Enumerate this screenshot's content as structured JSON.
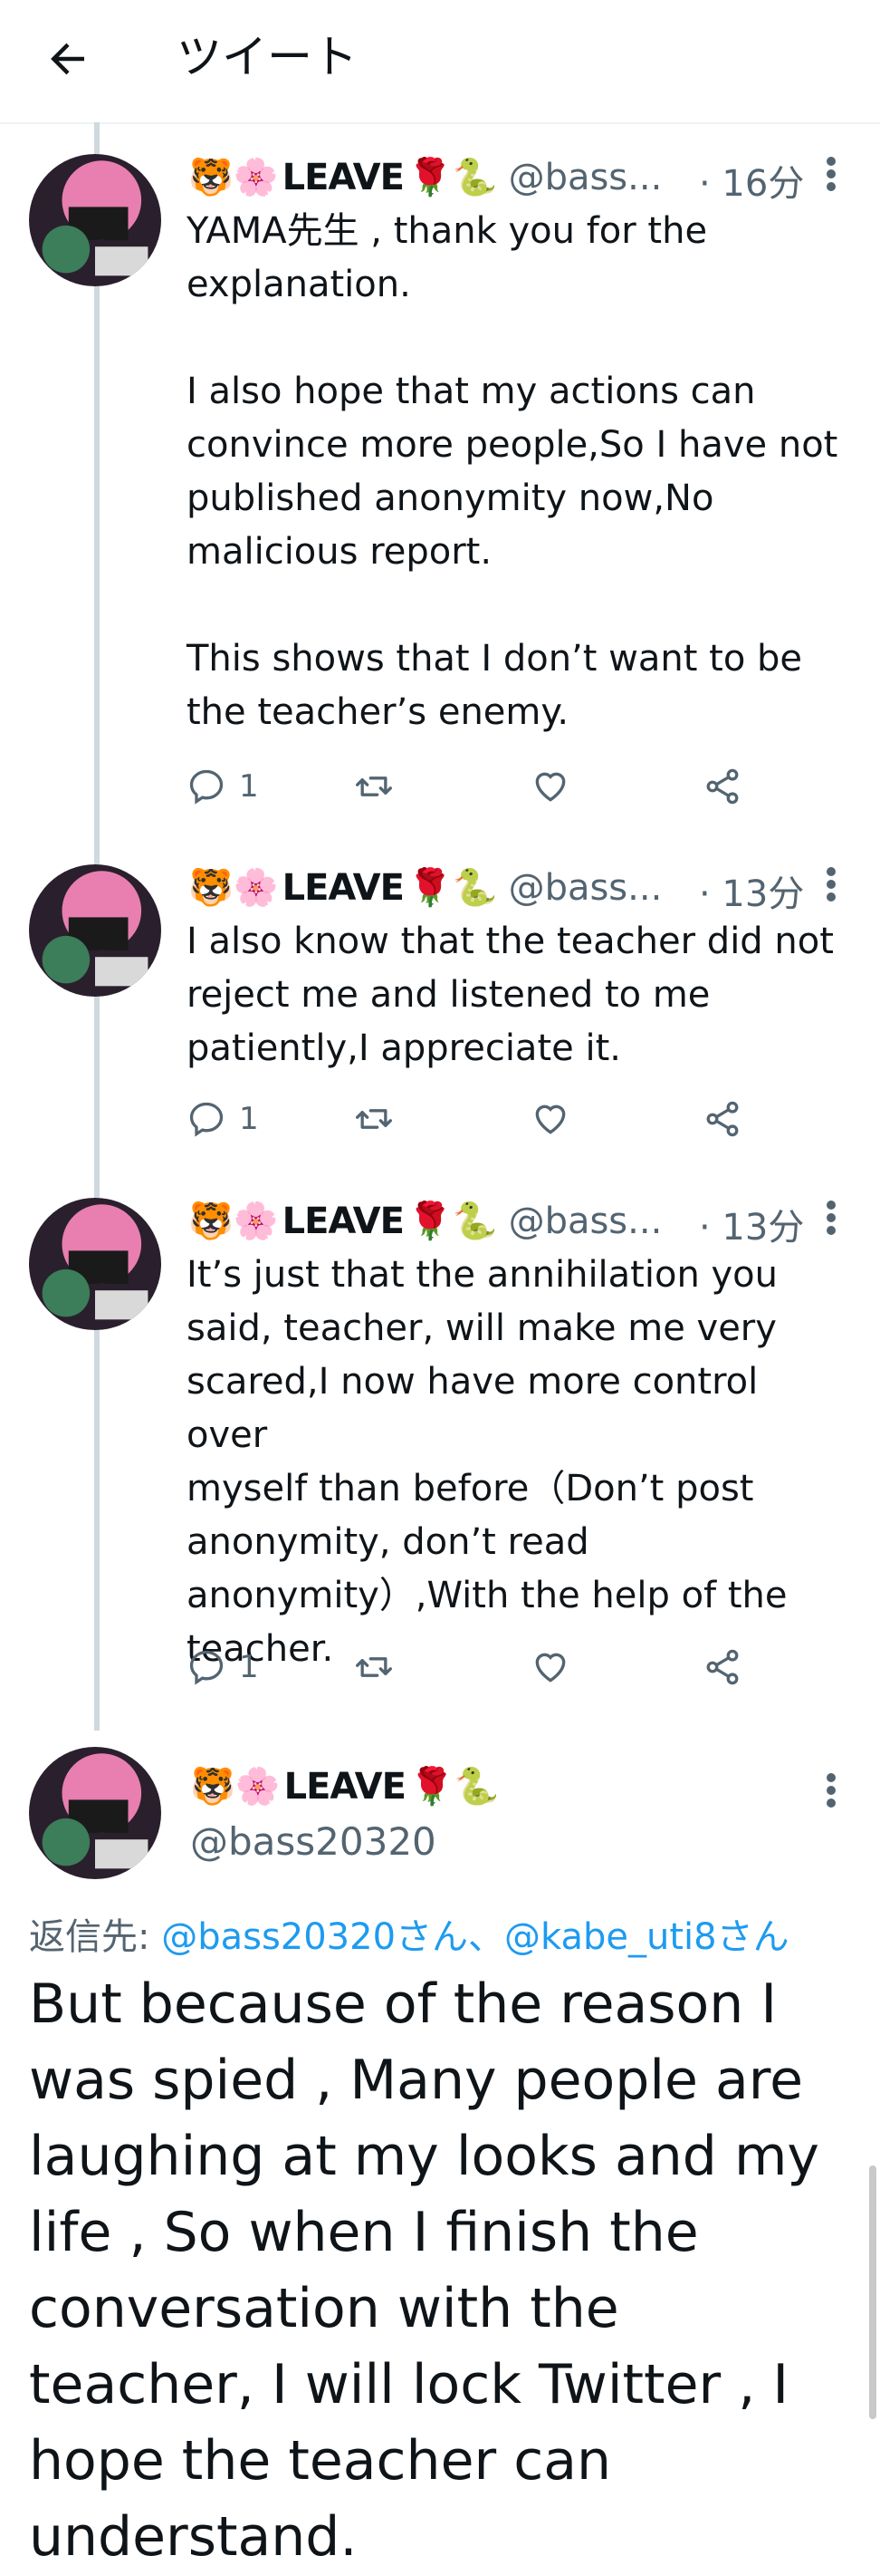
{
  "header": {
    "title": "ツイート"
  },
  "author": {
    "emoji_prefix": "🐯🌸",
    "name": "LEAVE",
    "emoji_suffix": "🌹🐍",
    "handle_short": "@bass...",
    "handle": "@bass20320"
  },
  "tweets": [
    {
      "time": "· 16分",
      "text": "YAMA先生 , thank you for the\nexplanation.\n\nI also hope that my actions can\nconvince more people,So I have not\npublished anonymity now,No\nmalicious report.\n\nThis shows that I don’t want to be\nthe teacher’s enemy.",
      "reply_count": "1"
    },
    {
      "time": "· 13分",
      "text": "I also know that the teacher did not\nreject me and listened to me\npatiently,I appreciate it.",
      "reply_count": "1"
    },
    {
      "time": "· 13分",
      "text": "It’s just that the annihilation you\nsaid, teacher, will make me very\nscared,I now have more control over\nmyself than before（Don’t post\nanonymity, don’t read\nanonymity）,With the help of the\nteacher.",
      "reply_count": "1"
    }
  ],
  "main_tweet": {
    "reply_prefix": "返信先: ",
    "reply_link_1": "@bass20320さん",
    "reply_sep": "、",
    "reply_link_2": "@kabe_uti8さん",
    "text": "But because of the reason I was spied , Many people are laughing at my looks and my life , So when I finish the conversation with the teacher, I will lock Twitter , I hope the teacher can understand."
  },
  "colors": {
    "link": "#1d9bf0",
    "secondary": "#536471",
    "thread_line": "#cfd9de"
  },
  "icons": [
    "back-arrow-icon",
    "more-icon",
    "reply-icon",
    "retweet-icon",
    "like-icon",
    "share-icon"
  ]
}
